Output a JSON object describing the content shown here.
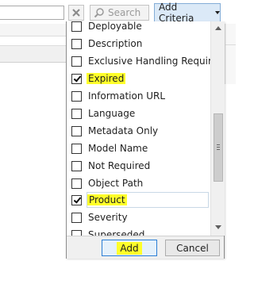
{
  "toolbar": {
    "clear_icon": "x-icon",
    "search_icon": "search-icon",
    "search_label": "Search",
    "add_criteria_label": "Add Criteria",
    "search_input_value": ""
  },
  "criteria_menu": {
    "items": [
      {
        "label": "Deployable",
        "checked": false,
        "highlighted": false
      },
      {
        "label": "Description",
        "checked": false,
        "highlighted": false
      },
      {
        "label": "Exclusive Handling Required",
        "checked": false,
        "highlighted": false
      },
      {
        "label": "Expired",
        "checked": true,
        "highlighted": true
      },
      {
        "label": "Information URL",
        "checked": false,
        "highlighted": false
      },
      {
        "label": "Language",
        "checked": false,
        "highlighted": false
      },
      {
        "label": "Metadata Only",
        "checked": false,
        "highlighted": false
      },
      {
        "label": "Model Name",
        "checked": false,
        "highlighted": false
      },
      {
        "label": "Not Required",
        "checked": false,
        "highlighted": false
      },
      {
        "label": "Object Path",
        "checked": false,
        "highlighted": false
      },
      {
        "label": "Product",
        "checked": true,
        "highlighted": true,
        "focused": true
      },
      {
        "label": "Severity",
        "checked": false,
        "highlighted": false
      },
      {
        "label": "Superseded",
        "checked": false,
        "highlighted": false
      }
    ],
    "add_label": "Add",
    "cancel_label": "Cancel"
  },
  "colors": {
    "highlight": "#ffff2a",
    "accent": "#2c7fd5",
    "criteria_button_bg": "#dbe9f7"
  }
}
